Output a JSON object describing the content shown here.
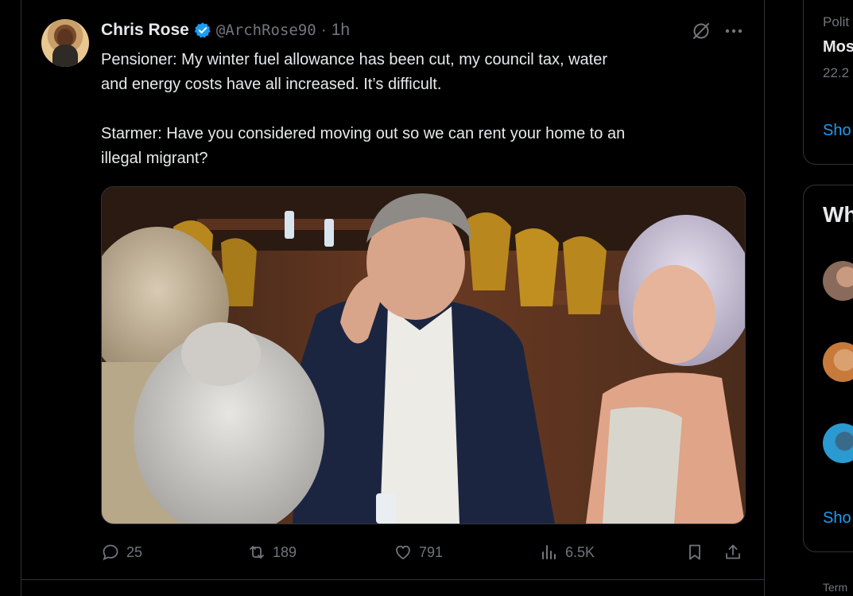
{
  "tweet": {
    "author_name": "Chris Rose",
    "handle": "@ArchRose90",
    "dot": "·",
    "time": "1h",
    "text": "Pensioner: My winter fuel allowance has been cut, my council tax, water\nand energy costs have all increased. It’s difficult.\n\nStarmer: Have you considered moving out so we can rent your home to an\nillegal migrant?",
    "replies": "25",
    "reposts": "189",
    "likes": "791",
    "views": "6.5K"
  },
  "sidebar": {
    "trend_category": "Polit",
    "trend_title": "Mos",
    "trend_count": "22.2",
    "show_more_1": "Sho",
    "who_to_follow_title": "Wh",
    "show_more_2": "Sho",
    "terms": "Term"
  },
  "colors": {
    "accent": "#1d9bf0",
    "muted": "#71767b",
    "border": "#2f3336",
    "text": "#e7e9ea"
  }
}
